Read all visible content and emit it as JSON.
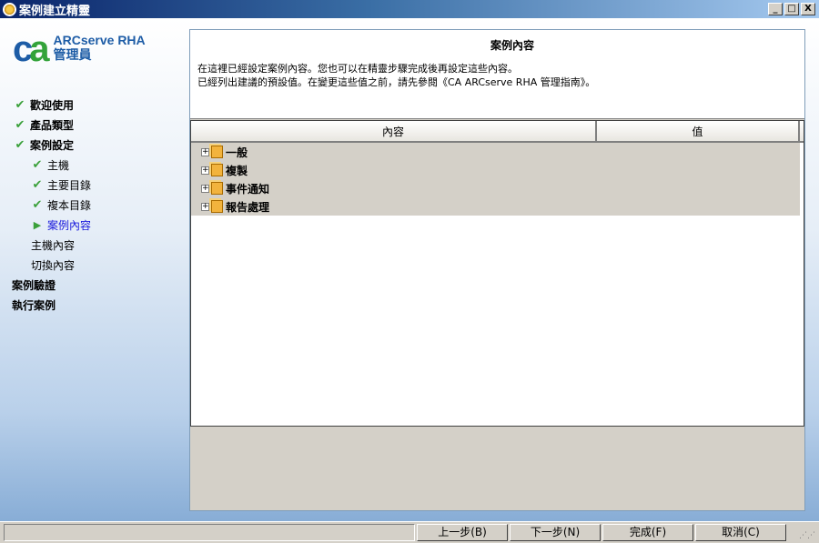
{
  "window": {
    "title": "案例建立精靈",
    "minimize": "_",
    "maximize": "□",
    "close": "X"
  },
  "logo": {
    "mark": "ca",
    "product": "ARCserve RHA",
    "subtitle": "管理員"
  },
  "steps": [
    {
      "label": "歡迎使用",
      "state": "done",
      "level": 0
    },
    {
      "label": "產品類型",
      "state": "done",
      "level": 0
    },
    {
      "label": "案例設定",
      "state": "done",
      "level": 0
    },
    {
      "label": "主機",
      "state": "done",
      "level": 1
    },
    {
      "label": "主要目錄",
      "state": "done",
      "level": 1
    },
    {
      "label": "複本目錄",
      "state": "done",
      "level": 1
    },
    {
      "label": "案例內容",
      "state": "current",
      "level": 1
    },
    {
      "label": "主機內容",
      "state": "pending",
      "level": 1
    },
    {
      "label": "切換內容",
      "state": "pending",
      "level": 1
    },
    {
      "label": "案例驗證",
      "state": "pending",
      "level": 0
    },
    {
      "label": "執行案例",
      "state": "pending",
      "level": 0
    }
  ],
  "header": {
    "title": "案例內容",
    "line1": "在這裡已經設定案例內容。您也可以在精靈步驟完成後再設定這些內容。",
    "line2": "已經列出建議的預設值。在變更這些值之前，請先參閱《CA ARCserve RHA 管理指南》。"
  },
  "grid": {
    "columns": [
      "內容",
      "值"
    ],
    "rows": [
      "一般",
      "複製",
      "事件通知",
      "報告處理"
    ]
  },
  "buttons": {
    "back": "上一步(B)",
    "next": "下一步(N)",
    "finish": "完成(F)",
    "cancel": "取消(C)"
  },
  "colors": {
    "check": "#3aa03a",
    "current": "#1a1adc",
    "brand": "#1d5ca6"
  }
}
